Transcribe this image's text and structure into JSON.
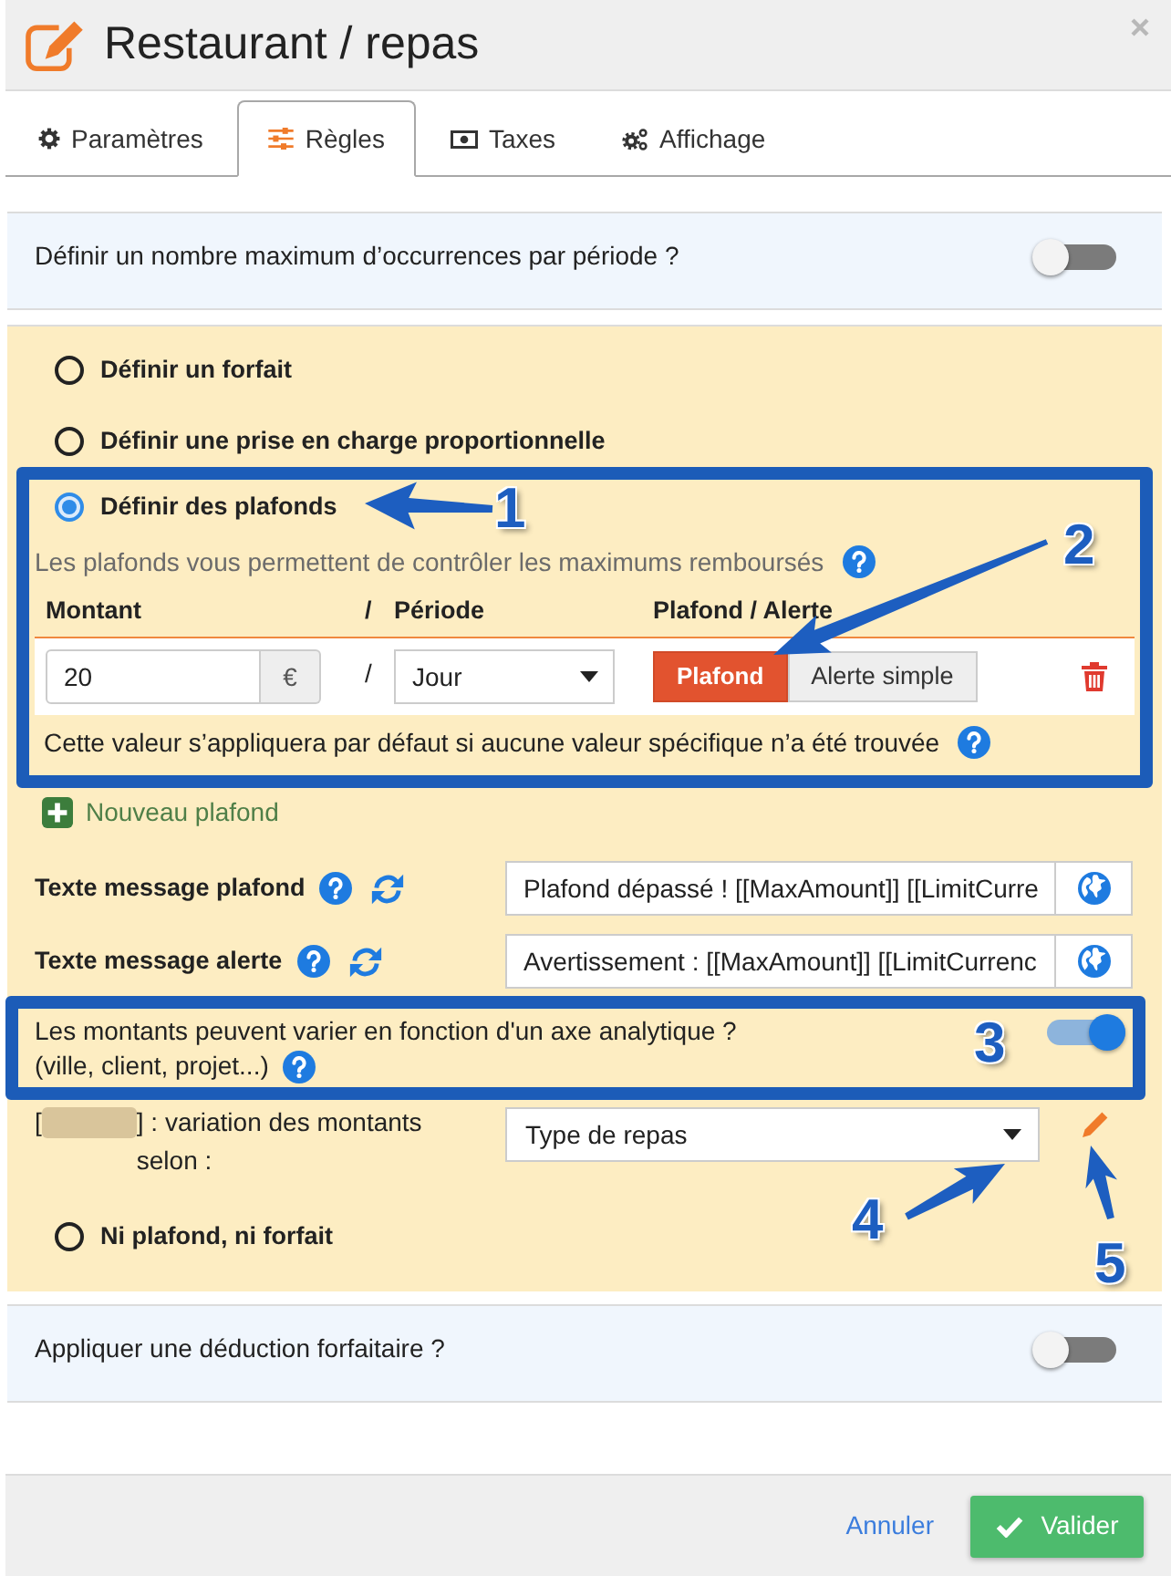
{
  "window": {
    "title": "Restaurant / repas"
  },
  "tabs": [
    {
      "label": "Paramètres",
      "selected": false
    },
    {
      "label": "Règles",
      "selected": true
    },
    {
      "label": "Taxes",
      "selected": false
    },
    {
      "label": "Affichage",
      "selected": false
    }
  ],
  "occurrence_limit": {
    "label": "Définir un nombre maximum d’occurrences par période ?",
    "on": false
  },
  "coverage": {
    "options": [
      {
        "label": "Définir un forfait",
        "selected": false
      },
      {
        "label": "Définir une prise en charge proportionnelle",
        "selected": false
      },
      {
        "label": "Définir des plafonds",
        "selected": true,
        "details": {
          "intro": "Les plafonds vous permettent de contrôler les maximums remboursés",
          "columns": [
            {
              "label": "Montant"
            },
            {
              "label": "/"
            },
            {
              "label": "Période"
            },
            {
              "label": "Plafond / Alerte"
            }
          ],
          "rows": [
            {
              "amount": "20",
              "currency": "€",
              "separator": "/",
              "period": "Jour",
              "modes": [
                {
                  "label": "Plafond",
                  "selected": true
                },
                {
                  "label": "Alerte simple",
                  "selected": false
                }
              ]
            }
          ],
          "note": "Cette valeur s’appliquera par défaut si aucune valeur spécifique n’a été trouvée",
          "add_link": "Nouveau plafond",
          "messages": [
            {
              "label": "Texte message plafond",
              "value": "Plafond dépassé ! [[MaxAmount]] [[LimitCurre"
            },
            {
              "label": "Texte message alerte",
              "value": "Avertissement : [[MaxAmount]] [[LimitCurrenc"
            }
          ],
          "analytic_axis": {
            "label": "Les montants peuvent varier en fonction d'un axe analytique ?",
            "hint": "(ville, client, projet...)",
            "on": true
          },
          "variation": {
            "label_start": "[",
            "label_end": "] : variation des montants selon :",
            "value": "Type de repas"
          }
        }
      },
      {
        "label": "Ni plafond, ni forfait",
        "selected": false
      }
    ]
  },
  "deduction": {
    "label": "Appliquer une déduction forfaitaire ?",
    "on": false
  },
  "footer": {
    "cancel": "Annuler",
    "confirm": "Valider"
  },
  "annotations": [
    {
      "label": "1"
    },
    {
      "label": "2"
    },
    {
      "label": "3"
    },
    {
      "label": "4"
    },
    {
      "label": "5"
    }
  ]
}
